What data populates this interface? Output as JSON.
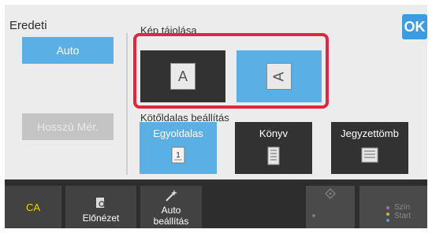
{
  "header": {
    "title": "Eredeti",
    "ok_label": "OK"
  },
  "left": {
    "auto_label": "Auto",
    "long_label": "Hosszú Mér."
  },
  "orientation": {
    "label": "Kép tájolása",
    "options": [
      {
        "glyph": "A",
        "state": "dark"
      },
      {
        "glyph": "A",
        "state": "selected"
      }
    ]
  },
  "binding": {
    "label": "Kötőldalas beállítás",
    "options": [
      {
        "label": "Egyoldalas",
        "state": "selected",
        "icon": "single-sided-icon"
      },
      {
        "label": "Könyv",
        "state": "dark",
        "icon": "book-icon"
      },
      {
        "label": "Jegyzettömb",
        "state": "dark",
        "icon": "tablet-icon"
      }
    ]
  },
  "bottom": {
    "ca_label": "CA",
    "preview_label": "Előnézet",
    "auto_settings_label": "Auto\nbeállítás",
    "color_start_label": "Szín\nStart"
  },
  "colors": {
    "accent": "#5ab0e4",
    "ok": "#3d9be0",
    "highlight": "#e0283c",
    "ca": "#f2d100"
  }
}
